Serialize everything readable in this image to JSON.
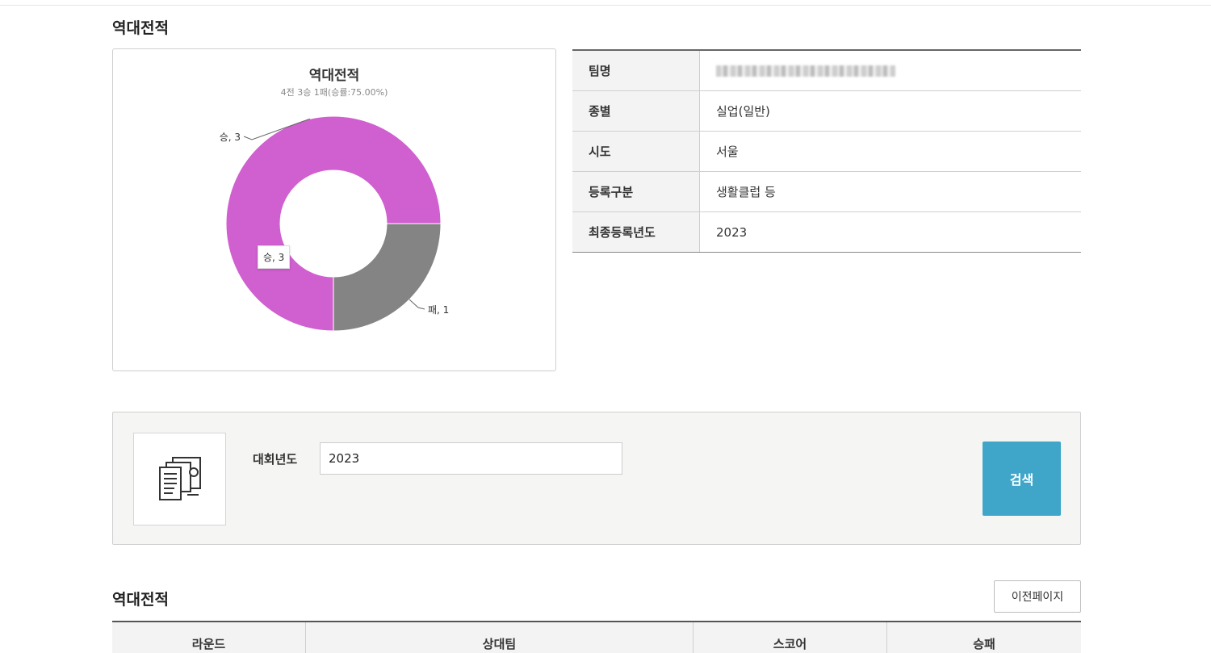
{
  "section_title": "역대전적",
  "chart_data": {
    "type": "pie",
    "title": "역대전적",
    "subtitle": "4전 3승 1패(승률:75.00%)",
    "donut": true,
    "slices": [
      {
        "label": "승",
        "value": 3,
        "data_label": "승, 3",
        "color": "#d05fcf"
      },
      {
        "label": "패",
        "value": 1,
        "data_label": "패, 1",
        "color": "#848484"
      }
    ],
    "tooltip": "승, 3"
  },
  "team_info": {
    "rows": [
      {
        "label": "팀명",
        "value": ""
      },
      {
        "label": "종별",
        "value": "실업(일반)"
      },
      {
        "label": "시도",
        "value": "서울"
      },
      {
        "label": "등록구분",
        "value": "생활클럽 등"
      },
      {
        "label": "최종등록년도",
        "value": "2023"
      }
    ]
  },
  "search": {
    "label": "대회년도",
    "value": "2023",
    "button_label": "검색"
  },
  "results": {
    "title": "역대전적",
    "prev_button_label": "이전페이지",
    "columns": [
      "라운드",
      "상대팀",
      "스코어",
      "승패"
    ]
  }
}
